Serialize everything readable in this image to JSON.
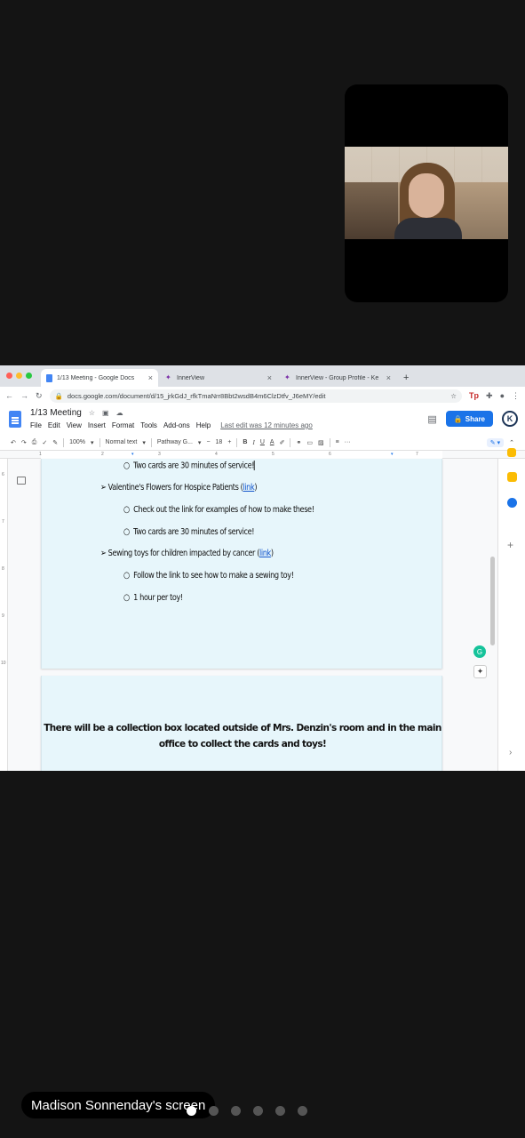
{
  "browser": {
    "tabs": [
      {
        "title": "1/13 Meeting - Google Docs",
        "icon": "google-docs-icon",
        "active": true
      },
      {
        "title": "InnerView",
        "icon": "innerview-icon",
        "active": false
      },
      {
        "title": "InnerView - Group Profile - Ke",
        "icon": "innerview-icon",
        "active": false
      }
    ],
    "url": "docs.google.com/document/d/15_jrkGdJ_rfkTmaNrr8Bbt2wsdB4m6ClzDtfv_J6eMY/edit"
  },
  "docs": {
    "title": "1/13 Meeting",
    "menu": [
      "File",
      "Edit",
      "View",
      "Insert",
      "Format",
      "Tools",
      "Add-ons",
      "Help"
    ],
    "last_edit": "Last edit was 12 minutes ago",
    "share_label": "Share",
    "avatar_initial": "K",
    "format_bar": {
      "zoom": "100%",
      "style": "Normal text",
      "font": "Pathway G...",
      "font_size": "18",
      "bold": "B",
      "italic": "I",
      "underline": "U",
      "text_color": "A",
      "minus": "−",
      "plus": "+"
    },
    "ruler_marks": [
      "1",
      "2",
      "3",
      "4",
      "5",
      "6",
      "7"
    ],
    "vruler_marks": [
      "6",
      "7",
      "8",
      "9",
      "10"
    ]
  },
  "content": {
    "line1": "Two cards are 30 minutes of service!",
    "bullet2_prefix": "Valentine's Flowers for Hospice Patients (",
    "bullet2_link": "link",
    "bullet2_suffix": ")",
    "line3": "Check out the link for examples of how to make these!",
    "line4": "Two cards are 30 minutes of service!",
    "bullet5_prefix": "Sewing toys for children impacted by cancer (",
    "bullet5_link": "link",
    "bullet5_suffix": ")",
    "line6": "Follow the link to see how to make a sewing toy!",
    "line7": "1 hour per toy!",
    "notice_line1": "There will be a collection box located outside of Mrs. Denzin's room and in the main",
    "notice_line2": "office to collect the cards and toys!"
  },
  "overlay": {
    "screen_label": "Madison Sonnenday's screen",
    "pager_count": 6,
    "pager_active_index": 0
  },
  "colors": {
    "page_background": "#e7f6fb",
    "share_blue": "#1a73e8",
    "link_blue": "#1155cc",
    "app_background": "#141414"
  }
}
